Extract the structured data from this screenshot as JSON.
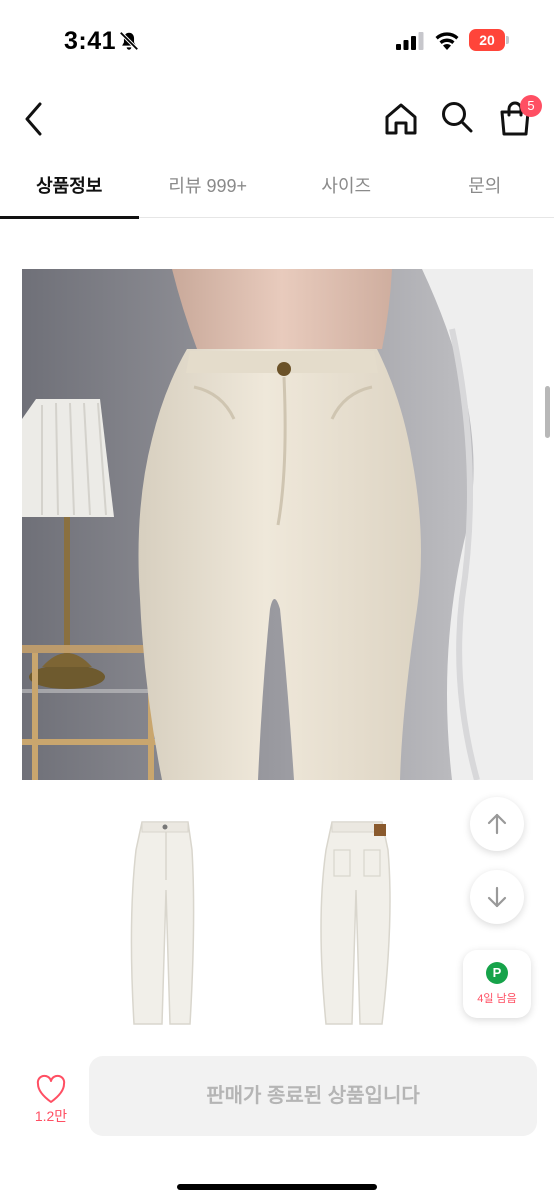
{
  "status_bar": {
    "time": "3:41",
    "battery": "20",
    "icons": [
      "bell-slash-icon",
      "cellular-signal-icon",
      "wifi-icon",
      "battery-low-icon"
    ]
  },
  "header": {
    "icons": [
      "chevron-left-icon",
      "home-icon",
      "search-icon",
      "shopping-bag-icon"
    ],
    "cart_badge": "5"
  },
  "tabs": [
    {
      "label": "상품정보",
      "active": true
    },
    {
      "label": "리뷰 999+",
      "active": false
    },
    {
      "label": "사이즈",
      "active": false
    },
    {
      "label": "문의",
      "active": false
    }
  ],
  "floating": {
    "up_icon": "arrow-up-icon",
    "down_icon": "arrow-down-icon",
    "point_badge": "P",
    "point_text": "4일 남음"
  },
  "bottom": {
    "like_icon": "heart-outline-icon",
    "like_count": "1.2만",
    "status_button": "판매가 종료된 상품입니다"
  },
  "colors": {
    "accent": "#ff4f63",
    "point_green": "#16a34a",
    "disabled_button_bg": "#f2f2f2",
    "disabled_button_text": "#b5b5b5"
  }
}
